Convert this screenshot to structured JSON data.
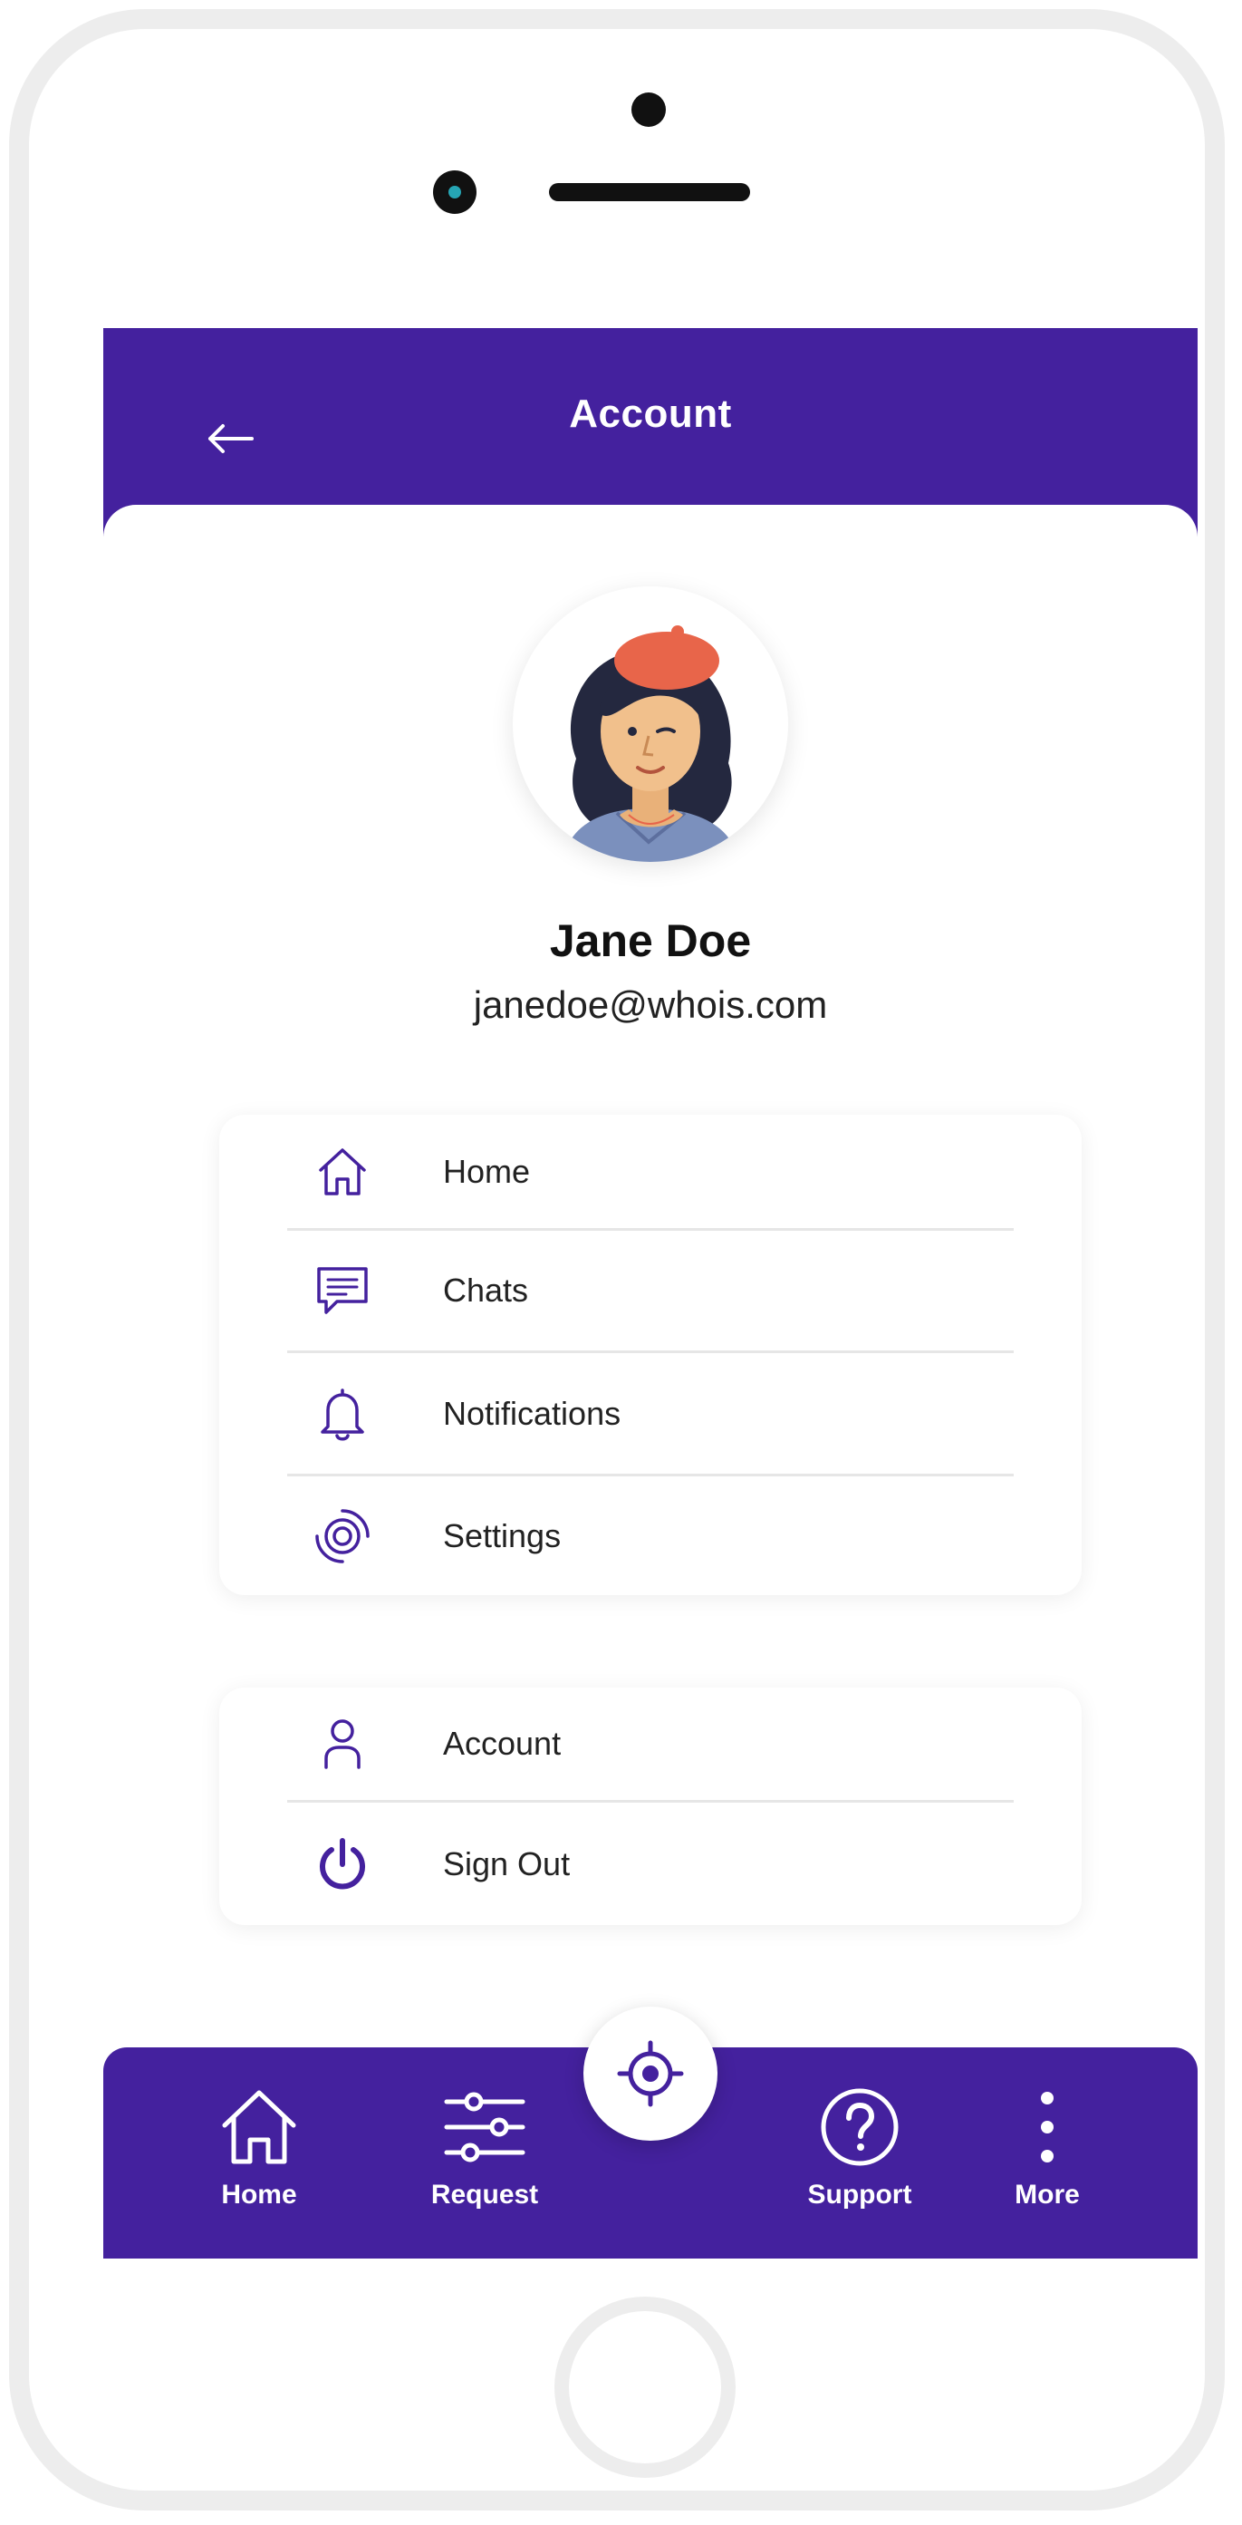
{
  "header": {
    "title": "Account"
  },
  "profile": {
    "name": "Jane Doe",
    "email": "janedoe@whois.com"
  },
  "menu_primary": [
    {
      "label": "Home",
      "icon": "home-icon"
    },
    {
      "label": "Chats",
      "icon": "chat-icon"
    },
    {
      "label": "Notifications",
      "icon": "bell-icon"
    },
    {
      "label": "Settings",
      "icon": "settings-icon"
    }
  ],
  "menu_secondary": [
    {
      "label": "Account",
      "icon": "user-icon"
    },
    {
      "label": "Sign Out",
      "icon": "power-icon"
    }
  ],
  "bottom_nav": [
    {
      "label": "Home",
      "icon": "home-icon"
    },
    {
      "label": "Request",
      "icon": "sliders-icon"
    },
    {
      "label": "Support",
      "icon": "help-icon"
    },
    {
      "label": "More",
      "icon": "more-vertical-icon"
    }
  ],
  "fab": {
    "icon": "locate-icon"
  },
  "colors": {
    "brand": "#44219e",
    "background": "#ffffff",
    "text": "#222222"
  }
}
